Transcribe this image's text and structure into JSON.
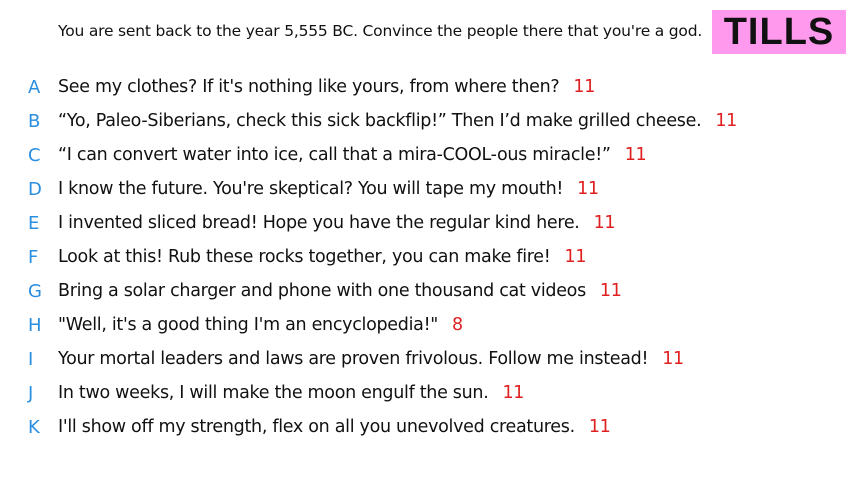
{
  "prompt": "You are sent back to the year 5,555 BC. Convince the people there that you're a god.",
  "badge": "TILLS",
  "colors": {
    "letter": "#2b8fe0",
    "score": "#e02020",
    "badge_bg": "#ff99ee"
  },
  "answers": [
    {
      "letter": "A",
      "text": "See my clothes? If it's nothing like yours, from where then?",
      "score": "11"
    },
    {
      "letter": "B",
      "text": "“Yo, Paleo-Siberians, check this sick backflip!” Then I’d make grilled cheese.",
      "score": "11"
    },
    {
      "letter": "C",
      "text": "“I can convert water into ice, call that a mira-COOL-ous miracle!”",
      "score": "11"
    },
    {
      "letter": "D",
      "text": "I know the future. You're skeptical? You will tape my mouth!",
      "score": "11"
    },
    {
      "letter": "E",
      "text": "I invented sliced bread! Hope you have the regular kind here.",
      "score": "11"
    },
    {
      "letter": "F",
      "text": "Look at this! Rub these rocks together, you can make fire!",
      "score": "11"
    },
    {
      "letter": "G",
      "text": "Bring a solar charger and phone with one thousand cat videos",
      "score": "11"
    },
    {
      "letter": "H",
      "text": "\"Well, it's a good thing I'm an encyclopedia!\"",
      "score": "8"
    },
    {
      "letter": "I",
      "text": "Your mortal leaders and laws are proven frivolous. Follow me instead!",
      "score": "11"
    },
    {
      "letter": "J",
      "text": "In two weeks, I will make the moon engulf the sun.",
      "score": "11"
    },
    {
      "letter": "K",
      "text": "I'll show off my strength, flex on all you unevolved creatures.",
      "score": "11"
    }
  ]
}
